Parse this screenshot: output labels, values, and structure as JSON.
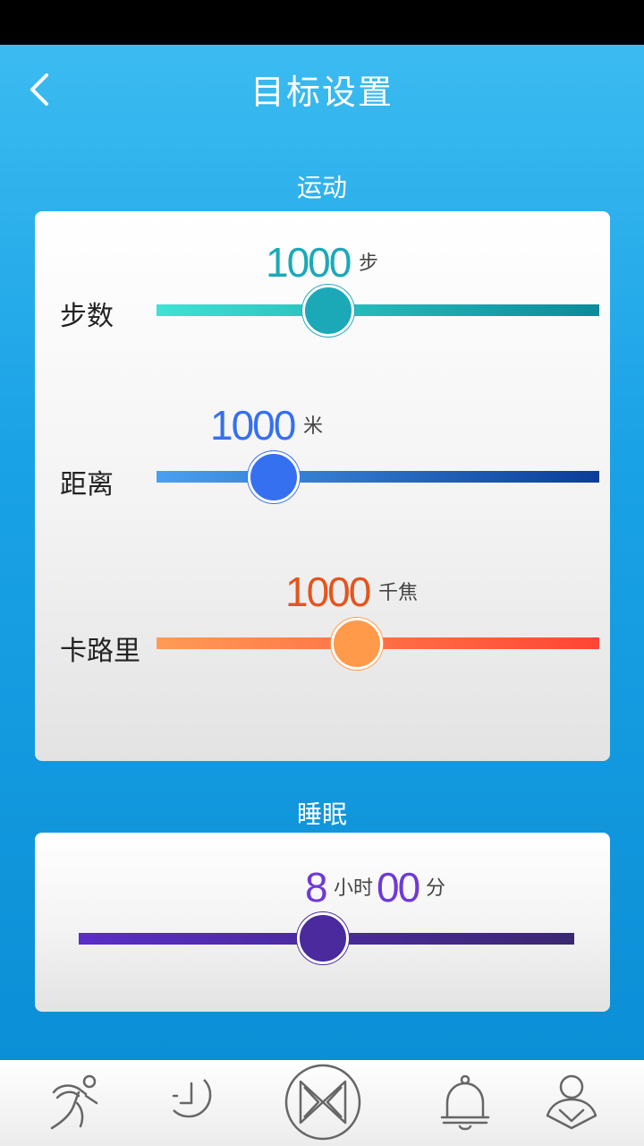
{
  "header": {
    "title": "目标设置"
  },
  "exercise": {
    "section_title": "运动",
    "steps": {
      "label": "步数",
      "value": "1000",
      "unit": "步",
      "color_start": "#3fe2d4",
      "color_end": "#0b8a9a",
      "knob_color": "#1ba9b8"
    },
    "distance": {
      "label": "距离",
      "value": "1000",
      "unit": "米",
      "color_start": "#4aa0f0",
      "color_end": "#0a3d99",
      "knob_color": "#3570f0"
    },
    "calories": {
      "label": "卡路里",
      "value": "1000",
      "unit": "千焦",
      "color_start": "#ff9b57",
      "color_end": "#ff4535",
      "knob_color": "#ff9a4a"
    }
  },
  "sleep": {
    "section_title": "睡眠",
    "hours": "8",
    "hours_unit": "小时",
    "minutes": "00",
    "minutes_unit": "分",
    "color_start": "#5a2dc8",
    "color_end": "#3a2870",
    "knob_color": "#4a2a9c"
  },
  "nav": {
    "items": [
      "activity-icon",
      "sleep-moon-icon",
      "home-logo-icon",
      "alarm-bell-icon",
      "profile-icon"
    ]
  }
}
